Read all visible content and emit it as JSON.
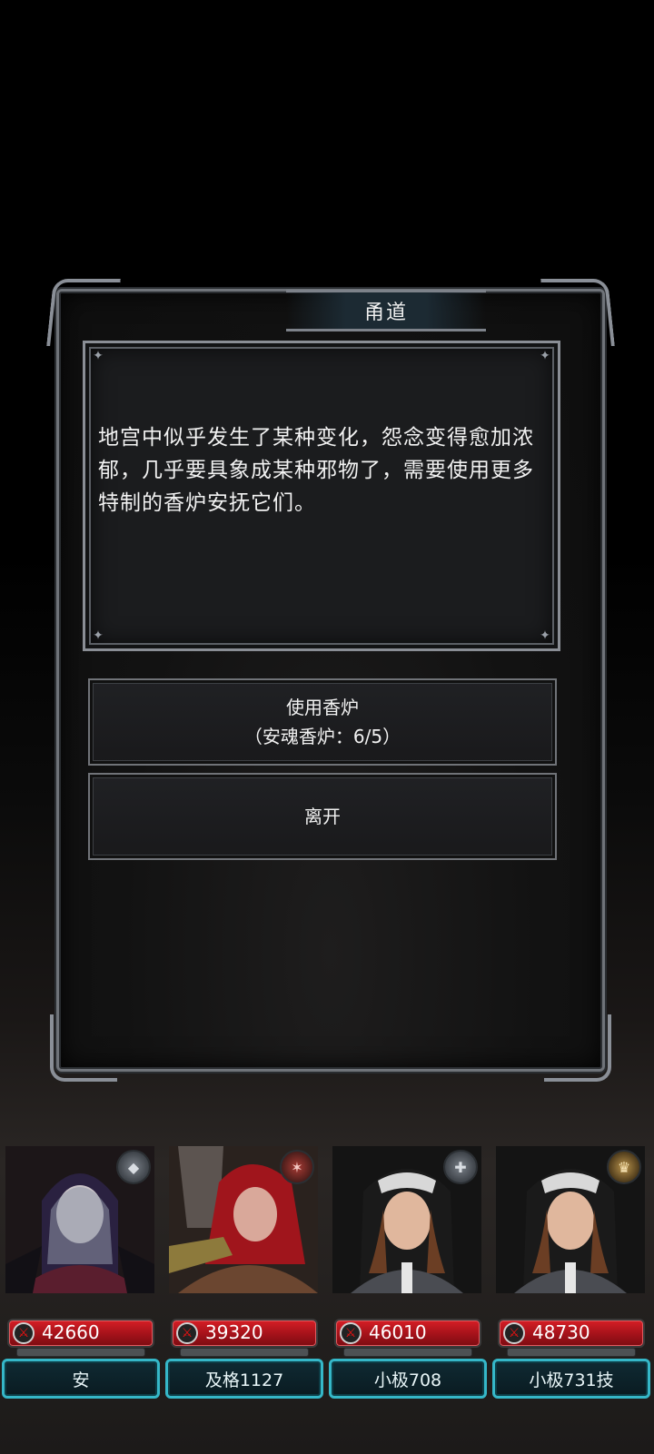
{
  "dialog": {
    "title": "甬道",
    "description": "地宫中似乎发生了某种变化，怨念变得愈加浓郁，几乎要具象成某种邪物了，需要使用更多特制的香炉安抚它们。",
    "options": [
      {
        "line1": "使用香炉",
        "line2": "（安魂香炉：6/5）"
      },
      {
        "line1": "离开"
      }
    ]
  },
  "party": [
    {
      "name": "安",
      "hp": "42660",
      "badge": "hood-badge-icon"
    },
    {
      "name": "及格1127",
      "hp": "39320",
      "badge": "flame-badge-icon"
    },
    {
      "name": "小极708",
      "hp": "46010",
      "badge": "cross-badge-icon"
    },
    {
      "name": "小极731技",
      "hp": "48730",
      "badge": "crown-badge-icon"
    }
  ],
  "colors": {
    "hp_bar": "#c4161e",
    "name_border": "#35b7c8",
    "frame": "#6f7379"
  }
}
